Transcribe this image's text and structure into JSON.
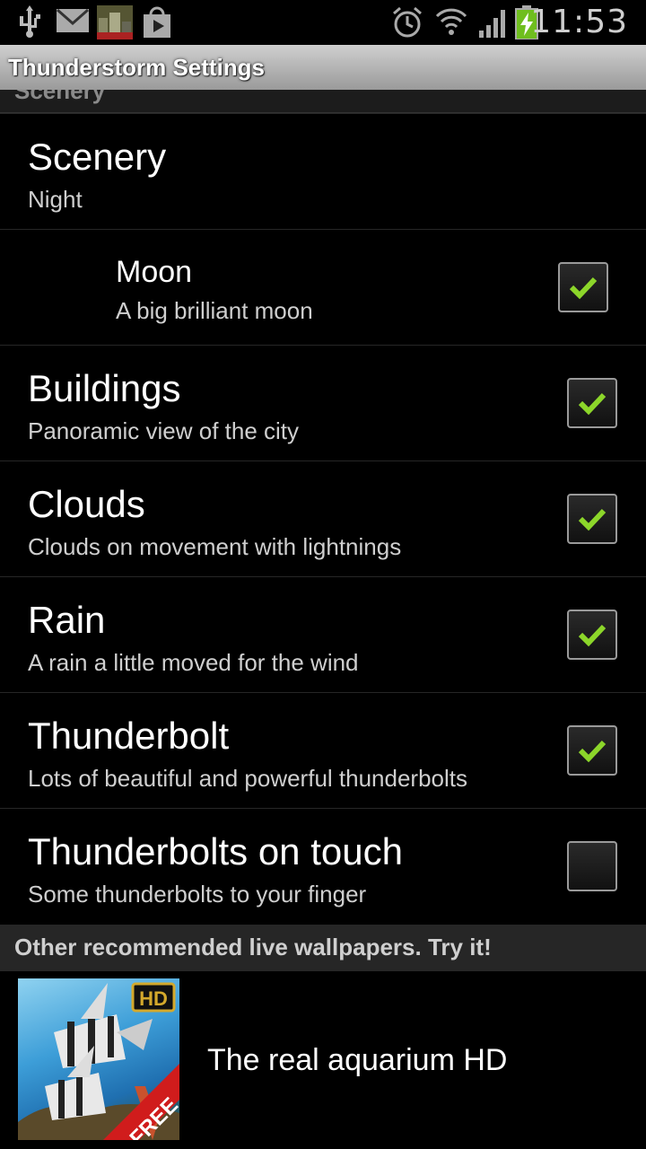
{
  "status_bar": {
    "time": "11:53",
    "icons": [
      "usb-icon",
      "gmail-icon",
      "app-thumbnail-icon",
      "play-store-icon",
      "alarm-icon",
      "wifi-icon",
      "signal-icon",
      "battery-charging-icon"
    ]
  },
  "titlebar": {
    "title": "Thunderstorm Settings"
  },
  "category_partial": "Scenery",
  "preferences": [
    {
      "title": "Scenery",
      "summary": "Night",
      "checkbox": false
    },
    {
      "title": "Moon",
      "summary": "A big brilliant moon",
      "checkbox": true,
      "checked": true,
      "indent": true
    },
    {
      "title": "Buildings",
      "summary": "Panoramic view of the city",
      "checkbox": true,
      "checked": true
    },
    {
      "title": "Clouds",
      "summary": "Clouds on movement with lightnings",
      "checkbox": true,
      "checked": true
    },
    {
      "title": "Rain",
      "summary": "A rain a little moved for the wind",
      "checkbox": true,
      "checked": true
    },
    {
      "title": "Thunderbolt",
      "summary": "Lots of beautiful and powerful thunderbolts",
      "checkbox": true,
      "checked": true
    },
    {
      "title": "Thunderbolts on touch",
      "summary": "Some thunderbolts to your finger",
      "checkbox": true,
      "checked": false
    }
  ],
  "recommended": {
    "header": "Other recommended live wallpapers. Try it!",
    "items": [
      {
        "title": "The real aquarium HD",
        "thumb_badge": "HD",
        "thumb_ribbon": "FREE"
      }
    ]
  },
  "colors": {
    "check_green": "#8cd62a",
    "background": "#000000"
  }
}
